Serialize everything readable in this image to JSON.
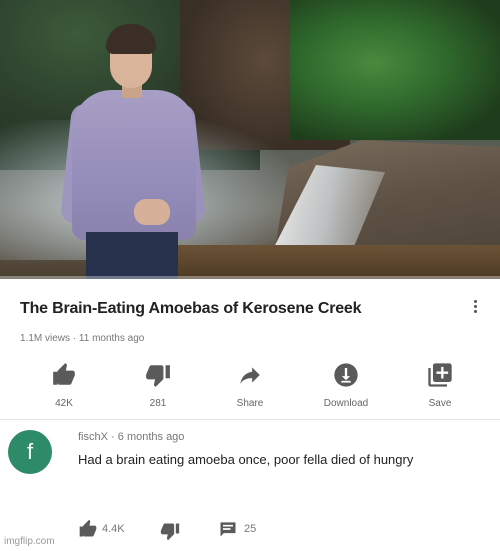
{
  "video": {
    "title": "The Brain-Eating Amoebas of Kerosene Creek",
    "views": "1.1M views",
    "age": "11 months ago",
    "progress_fraction": 0.0
  },
  "actions": [
    {
      "icon": "thumbs-up-icon",
      "label": "42K"
    },
    {
      "icon": "thumbs-down-icon",
      "label": "281"
    },
    {
      "icon": "share-icon",
      "label": "Share"
    },
    {
      "icon": "download-icon",
      "label": "Download"
    },
    {
      "icon": "save-icon",
      "label": "Save"
    }
  ],
  "comment": {
    "avatar_letter": "f",
    "avatar_color": "#2e8b68",
    "author": "fischX",
    "age": "6 months ago",
    "text": "Had a brain eating amoeba once, poor fella died of hungry",
    "likes": "4.4K",
    "replies": "25"
  },
  "watermark": "imgflip.com"
}
